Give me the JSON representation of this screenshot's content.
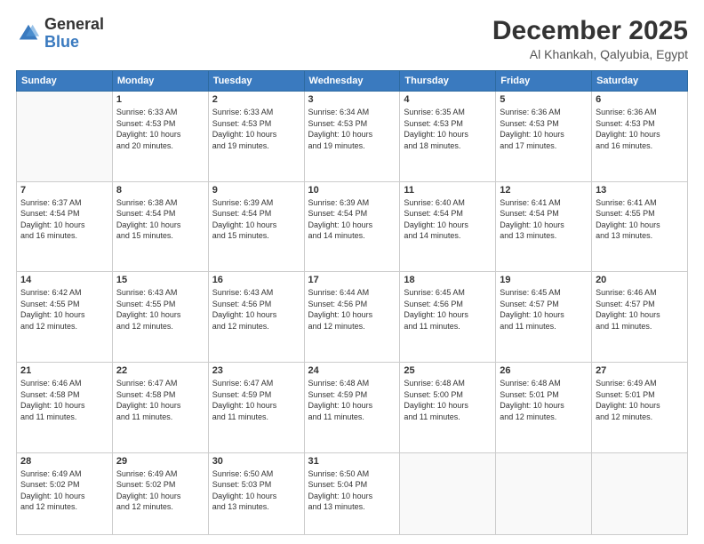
{
  "logo": {
    "general": "General",
    "blue": "Blue"
  },
  "header": {
    "month": "December 2025",
    "location": "Al Khankah, Qalyubia, Egypt"
  },
  "days_of_week": [
    "Sunday",
    "Monday",
    "Tuesday",
    "Wednesday",
    "Thursday",
    "Friday",
    "Saturday"
  ],
  "weeks": [
    [
      {
        "day": "",
        "info": ""
      },
      {
        "day": "1",
        "info": "Sunrise: 6:33 AM\nSunset: 4:53 PM\nDaylight: 10 hours\nand 20 minutes."
      },
      {
        "day": "2",
        "info": "Sunrise: 6:33 AM\nSunset: 4:53 PM\nDaylight: 10 hours\nand 19 minutes."
      },
      {
        "day": "3",
        "info": "Sunrise: 6:34 AM\nSunset: 4:53 PM\nDaylight: 10 hours\nand 19 minutes."
      },
      {
        "day": "4",
        "info": "Sunrise: 6:35 AM\nSunset: 4:53 PM\nDaylight: 10 hours\nand 18 minutes."
      },
      {
        "day": "5",
        "info": "Sunrise: 6:36 AM\nSunset: 4:53 PM\nDaylight: 10 hours\nand 17 minutes."
      },
      {
        "day": "6",
        "info": "Sunrise: 6:36 AM\nSunset: 4:53 PM\nDaylight: 10 hours\nand 16 minutes."
      }
    ],
    [
      {
        "day": "7",
        "info": "Sunrise: 6:37 AM\nSunset: 4:54 PM\nDaylight: 10 hours\nand 16 minutes."
      },
      {
        "day": "8",
        "info": "Sunrise: 6:38 AM\nSunset: 4:54 PM\nDaylight: 10 hours\nand 15 minutes."
      },
      {
        "day": "9",
        "info": "Sunrise: 6:39 AM\nSunset: 4:54 PM\nDaylight: 10 hours\nand 15 minutes."
      },
      {
        "day": "10",
        "info": "Sunrise: 6:39 AM\nSunset: 4:54 PM\nDaylight: 10 hours\nand 14 minutes."
      },
      {
        "day": "11",
        "info": "Sunrise: 6:40 AM\nSunset: 4:54 PM\nDaylight: 10 hours\nand 14 minutes."
      },
      {
        "day": "12",
        "info": "Sunrise: 6:41 AM\nSunset: 4:54 PM\nDaylight: 10 hours\nand 13 minutes."
      },
      {
        "day": "13",
        "info": "Sunrise: 6:41 AM\nSunset: 4:55 PM\nDaylight: 10 hours\nand 13 minutes."
      }
    ],
    [
      {
        "day": "14",
        "info": "Sunrise: 6:42 AM\nSunset: 4:55 PM\nDaylight: 10 hours\nand 12 minutes."
      },
      {
        "day": "15",
        "info": "Sunrise: 6:43 AM\nSunset: 4:55 PM\nDaylight: 10 hours\nand 12 minutes."
      },
      {
        "day": "16",
        "info": "Sunrise: 6:43 AM\nSunset: 4:56 PM\nDaylight: 10 hours\nand 12 minutes."
      },
      {
        "day": "17",
        "info": "Sunrise: 6:44 AM\nSunset: 4:56 PM\nDaylight: 10 hours\nand 12 minutes."
      },
      {
        "day": "18",
        "info": "Sunrise: 6:45 AM\nSunset: 4:56 PM\nDaylight: 10 hours\nand 11 minutes."
      },
      {
        "day": "19",
        "info": "Sunrise: 6:45 AM\nSunset: 4:57 PM\nDaylight: 10 hours\nand 11 minutes."
      },
      {
        "day": "20",
        "info": "Sunrise: 6:46 AM\nSunset: 4:57 PM\nDaylight: 10 hours\nand 11 minutes."
      }
    ],
    [
      {
        "day": "21",
        "info": "Sunrise: 6:46 AM\nSunset: 4:58 PM\nDaylight: 10 hours\nand 11 minutes."
      },
      {
        "day": "22",
        "info": "Sunrise: 6:47 AM\nSunset: 4:58 PM\nDaylight: 10 hours\nand 11 minutes."
      },
      {
        "day": "23",
        "info": "Sunrise: 6:47 AM\nSunset: 4:59 PM\nDaylight: 10 hours\nand 11 minutes."
      },
      {
        "day": "24",
        "info": "Sunrise: 6:48 AM\nSunset: 4:59 PM\nDaylight: 10 hours\nand 11 minutes."
      },
      {
        "day": "25",
        "info": "Sunrise: 6:48 AM\nSunset: 5:00 PM\nDaylight: 10 hours\nand 11 minutes."
      },
      {
        "day": "26",
        "info": "Sunrise: 6:48 AM\nSunset: 5:01 PM\nDaylight: 10 hours\nand 12 minutes."
      },
      {
        "day": "27",
        "info": "Sunrise: 6:49 AM\nSunset: 5:01 PM\nDaylight: 10 hours\nand 12 minutes."
      }
    ],
    [
      {
        "day": "28",
        "info": "Sunrise: 6:49 AM\nSunset: 5:02 PM\nDaylight: 10 hours\nand 12 minutes."
      },
      {
        "day": "29",
        "info": "Sunrise: 6:49 AM\nSunset: 5:02 PM\nDaylight: 10 hours\nand 12 minutes."
      },
      {
        "day": "30",
        "info": "Sunrise: 6:50 AM\nSunset: 5:03 PM\nDaylight: 10 hours\nand 13 minutes."
      },
      {
        "day": "31",
        "info": "Sunrise: 6:50 AM\nSunset: 5:04 PM\nDaylight: 10 hours\nand 13 minutes."
      },
      {
        "day": "",
        "info": ""
      },
      {
        "day": "",
        "info": ""
      },
      {
        "day": "",
        "info": ""
      }
    ]
  ]
}
